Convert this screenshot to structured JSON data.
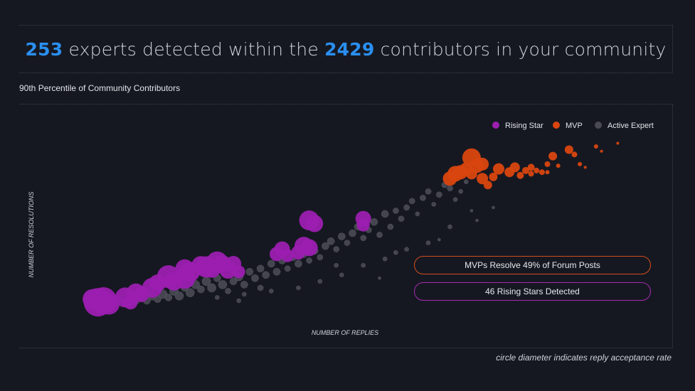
{
  "headline": {
    "experts_count": "253",
    "text1": "experts detected within the",
    "contributors_count": "2429",
    "text2": "contributors in your community"
  },
  "subtitle": "90th Percentile of Community Contributors",
  "footnote": "circle diameter indicates reply acceptance rate",
  "callouts": {
    "mvp": "MVPs Resolve 49% of Forum Posts",
    "rising": "46 Rising Stars Detected"
  },
  "colors": {
    "background": "#161821",
    "accent_number": "#2a8ff0",
    "rising_star": "#9b1fb0",
    "mvp": "#d9460f",
    "active_expert": "#4a4a55"
  },
  "chart_data": {
    "type": "scatter",
    "xlabel": "NUMBER OF REPLIES",
    "ylabel": "NUMBER OF RESOLUTIONS",
    "xlim": [
      0,
      100
    ],
    "ylim": [
      0,
      100
    ],
    "axis_ticks_shown": false,
    "grid": false,
    "legend_position": "top-right",
    "size_encoding": "reply acceptance rate",
    "legend": [
      {
        "name": "Rising Star",
        "color": "#9b1fb0"
      },
      {
        "name": "MVP",
        "color": "#d9460f"
      },
      {
        "name": "Active Expert",
        "color": "#4a4a55"
      }
    ],
    "series": [
      {
        "name": "Rising Star",
        "color": "#9b1fb0",
        "points": [
          {
            "x": 3,
            "y": 3,
            "s": 20
          },
          {
            "x": 4,
            "y": 4,
            "s": 19
          },
          {
            "x": 5,
            "y": 2,
            "s": 15
          },
          {
            "x": 2,
            "y": 5,
            "s": 14
          },
          {
            "x": 8,
            "y": 6,
            "s": 14
          },
          {
            "x": 9,
            "y": 3,
            "s": 10
          },
          {
            "x": 10,
            "y": 9,
            "s": 13
          },
          {
            "x": 11,
            "y": 8,
            "s": 11
          },
          {
            "x": 13,
            "y": 12,
            "s": 14
          },
          {
            "x": 14,
            "y": 15,
            "s": 12
          },
          {
            "x": 16,
            "y": 19,
            "s": 16
          },
          {
            "x": 17,
            "y": 16,
            "s": 13
          },
          {
            "x": 19,
            "y": 18,
            "s": 15
          },
          {
            "x": 19,
            "y": 24,
            "s": 13
          },
          {
            "x": 20,
            "y": 22,
            "s": 14
          },
          {
            "x": 22,
            "y": 26,
            "s": 13
          },
          {
            "x": 23,
            "y": 25,
            "s": 15
          },
          {
            "x": 24,
            "y": 24,
            "s": 13
          },
          {
            "x": 25,
            "y": 28,
            "s": 15
          },
          {
            "x": 26,
            "y": 27,
            "s": 12
          },
          {
            "x": 27,
            "y": 23,
            "s": 12
          },
          {
            "x": 28,
            "y": 27,
            "s": 11
          },
          {
            "x": 29,
            "y": 22,
            "s": 9
          },
          {
            "x": 36,
            "y": 33,
            "s": 10
          },
          {
            "x": 37,
            "y": 36,
            "s": 11
          },
          {
            "x": 38,
            "y": 32,
            "s": 9
          },
          {
            "x": 40,
            "y": 34,
            "s": 10
          },
          {
            "x": 41,
            "y": 38,
            "s": 13
          },
          {
            "x": 42,
            "y": 37,
            "s": 12
          },
          {
            "x": 42,
            "y": 54,
            "s": 14
          },
          {
            "x": 43,
            "y": 52,
            "s": 12
          },
          {
            "x": 52,
            "y": 55,
            "s": 11
          },
          {
            "x": 52,
            "y": 51,
            "s": 9
          }
        ]
      },
      {
        "name": "MVP",
        "color": "#d9460f",
        "points": [
          {
            "x": 68,
            "y": 80,
            "s": 10
          },
          {
            "x": 69,
            "y": 83,
            "s": 11
          },
          {
            "x": 70,
            "y": 84,
            "s": 10
          },
          {
            "x": 71,
            "y": 86,
            "s": 9
          },
          {
            "x": 72,
            "y": 93,
            "s": 13
          },
          {
            "x": 73,
            "y": 88,
            "s": 10
          },
          {
            "x": 74,
            "y": 89,
            "s": 9
          },
          {
            "x": 72,
            "y": 83,
            "s": 8
          },
          {
            "x": 74,
            "y": 80,
            "s": 8
          },
          {
            "x": 75,
            "y": 76,
            "s": 6
          },
          {
            "x": 76,
            "y": 81,
            "s": 6
          },
          {
            "x": 77,
            "y": 86,
            "s": 8
          },
          {
            "x": 79,
            "y": 84,
            "s": 7
          },
          {
            "x": 80,
            "y": 87,
            "s": 7
          },
          {
            "x": 81,
            "y": 82,
            "s": 5
          },
          {
            "x": 82,
            "y": 85,
            "s": 5
          },
          {
            "x": 83,
            "y": 87,
            "s": 5
          },
          {
            "x": 83,
            "y": 83,
            "s": 4
          },
          {
            "x": 84,
            "y": 85,
            "s": 4
          },
          {
            "x": 85,
            "y": 84,
            "s": 4
          },
          {
            "x": 86,
            "y": 84,
            "s": 3
          },
          {
            "x": 86,
            "y": 89,
            "s": 4
          },
          {
            "x": 87,
            "y": 94,
            "s": 6
          },
          {
            "x": 88,
            "y": 88,
            "s": 3
          },
          {
            "x": 90,
            "y": 98,
            "s": 6
          },
          {
            "x": 91,
            "y": 95,
            "s": 4
          },
          {
            "x": 92,
            "y": 89,
            "s": 3
          },
          {
            "x": 93,
            "y": 87,
            "s": 2
          },
          {
            "x": 95,
            "y": 100,
            "s": 3
          },
          {
            "x": 96,
            "y": 97,
            "s": 2
          },
          {
            "x": 99,
            "y": 102,
            "s": 2
          }
        ]
      },
      {
        "name": "Active Expert",
        "color": "#4a4a55",
        "points": [
          {
            "x": 6,
            "y": 3,
            "s": 6
          },
          {
            "x": 7,
            "y": 5,
            "s": 5
          },
          {
            "x": 8,
            "y": 3,
            "s": 5
          },
          {
            "x": 9,
            "y": 6,
            "s": 6
          },
          {
            "x": 10,
            "y": 4,
            "s": 5
          },
          {
            "x": 11,
            "y": 6,
            "s": 6
          },
          {
            "x": 12,
            "y": 4,
            "s": 5
          },
          {
            "x": 13,
            "y": 7,
            "s": 6
          },
          {
            "x": 14,
            "y": 5,
            "s": 5
          },
          {
            "x": 15,
            "y": 8,
            "s": 6
          },
          {
            "x": 16,
            "y": 6,
            "s": 5
          },
          {
            "x": 17,
            "y": 10,
            "s": 6
          },
          {
            "x": 18,
            "y": 7,
            "s": 6
          },
          {
            "x": 19,
            "y": 12,
            "s": 5
          },
          {
            "x": 20,
            "y": 9,
            "s": 6
          },
          {
            "x": 21,
            "y": 14,
            "s": 6
          },
          {
            "x": 22,
            "y": 11,
            "s": 5
          },
          {
            "x": 23,
            "y": 16,
            "s": 6
          },
          {
            "x": 24,
            "y": 12,
            "s": 6
          },
          {
            "x": 25,
            "y": 18,
            "s": 5
          },
          {
            "x": 26,
            "y": 14,
            "s": 6
          },
          {
            "x": 27,
            "y": 10,
            "s": 4
          },
          {
            "x": 28,
            "y": 16,
            "s": 5
          },
          {
            "x": 29,
            "y": 19,
            "s": 6
          },
          {
            "x": 30,
            "y": 14,
            "s": 5
          },
          {
            "x": 31,
            "y": 22,
            "s": 5
          },
          {
            "x": 32,
            "y": 18,
            "s": 5
          },
          {
            "x": 33,
            "y": 24,
            "s": 5
          },
          {
            "x": 33,
            "y": 12,
            "s": 4
          },
          {
            "x": 34,
            "y": 20,
            "s": 5
          },
          {
            "x": 35,
            "y": 27,
            "s": 5
          },
          {
            "x": 36,
            "y": 22,
            "s": 5
          },
          {
            "x": 37,
            "y": 29,
            "s": 5
          },
          {
            "x": 38,
            "y": 24,
            "s": 4
          },
          {
            "x": 39,
            "y": 31,
            "s": 5
          },
          {
            "x": 40,
            "y": 27,
            "s": 5
          },
          {
            "x": 41,
            "y": 33,
            "s": 5
          },
          {
            "x": 42,
            "y": 29,
            "s": 4
          },
          {
            "x": 43,
            "y": 35,
            "s": 5
          },
          {
            "x": 44,
            "y": 31,
            "s": 4
          },
          {
            "x": 45,
            "y": 38,
            "s": 5
          },
          {
            "x": 46,
            "y": 41,
            "s": 5
          },
          {
            "x": 47,
            "y": 36,
            "s": 4
          },
          {
            "x": 48,
            "y": 44,
            "s": 5
          },
          {
            "x": 49,
            "y": 40,
            "s": 4
          },
          {
            "x": 50,
            "y": 46,
            "s": 5
          },
          {
            "x": 51,
            "y": 50,
            "s": 5
          },
          {
            "x": 52,
            "y": 43,
            "s": 4
          },
          {
            "x": 53,
            "y": 48,
            "s": 4
          },
          {
            "x": 54,
            "y": 53,
            "s": 5
          },
          {
            "x": 55,
            "y": 45,
            "s": 4
          },
          {
            "x": 56,
            "y": 58,
            "s": 5
          },
          {
            "x": 57,
            "y": 50,
            "s": 4
          },
          {
            "x": 58,
            "y": 60,
            "s": 4
          },
          {
            "x": 59,
            "y": 55,
            "s": 4
          },
          {
            "x": 60,
            "y": 62,
            "s": 4
          },
          {
            "x": 61,
            "y": 66,
            "s": 4
          },
          {
            "x": 62,
            "y": 58,
            "s": 3
          },
          {
            "x": 63,
            "y": 68,
            "s": 4
          },
          {
            "x": 64,
            "y": 72,
            "s": 4
          },
          {
            "x": 65,
            "y": 64,
            "s": 3
          },
          {
            "x": 66,
            "y": 70,
            "s": 4
          },
          {
            "x": 67,
            "y": 76,
            "s": 4
          },
          {
            "x": 68,
            "y": 74,
            "s": 4
          },
          {
            "x": 69,
            "y": 67,
            "s": 3
          },
          {
            "x": 70,
            "y": 72,
            "s": 3
          },
          {
            "x": 71,
            "y": 78,
            "s": 3
          },
          {
            "x": 30,
            "y": 8,
            "s": 3
          },
          {
            "x": 35,
            "y": 10,
            "s": 3
          },
          {
            "x": 40,
            "y": 12,
            "s": 3
          },
          {
            "x": 44,
            "y": 16,
            "s": 3
          },
          {
            "x": 48,
            "y": 20,
            "s": 3
          },
          {
            "x": 52,
            "y": 26,
            "s": 3
          },
          {
            "x": 56,
            "y": 30,
            "s": 3
          },
          {
            "x": 60,
            "y": 36,
            "s": 3
          },
          {
            "x": 64,
            "y": 40,
            "s": 3
          },
          {
            "x": 68,
            "y": 50,
            "s": 3
          },
          {
            "x": 72,
            "y": 60,
            "s": 2
          },
          {
            "x": 25,
            "y": 6,
            "s": 3
          },
          {
            "x": 29,
            "y": 4,
            "s": 3
          },
          {
            "x": 47,
            "y": 26,
            "s": 3
          },
          {
            "x": 58,
            "y": 34,
            "s": 3
          },
          {
            "x": 73,
            "y": 54,
            "s": 2
          },
          {
            "x": 76,
            "y": 62,
            "s": 2
          },
          {
            "x": 66,
            "y": 42,
            "s": 2
          },
          {
            "x": 55,
            "y": 18,
            "s": 2
          }
        ]
      }
    ]
  }
}
